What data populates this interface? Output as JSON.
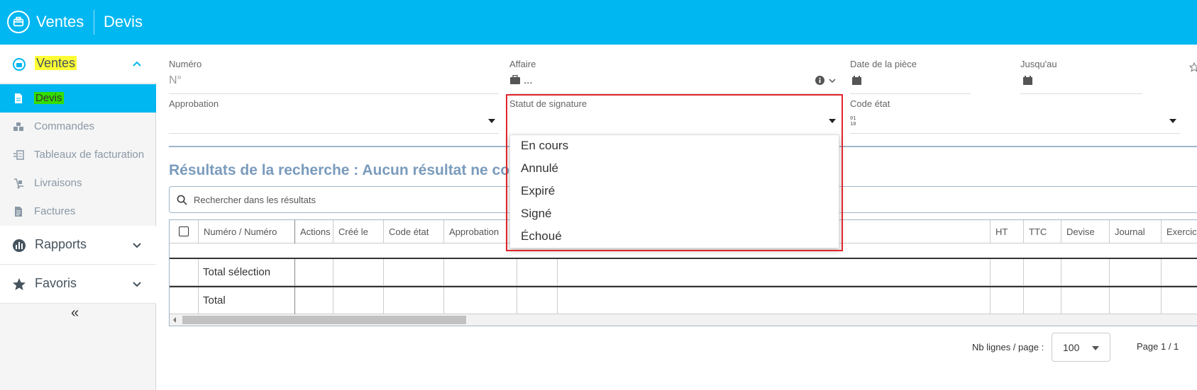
{
  "topbar": {
    "app": "Ventes",
    "page": "Devis"
  },
  "sidebar": {
    "ventes_section": "Ventes",
    "items": [
      {
        "label": "Devis",
        "icon": "document-icon",
        "active": true
      },
      {
        "label": "Commandes",
        "icon": "boxes-icon"
      },
      {
        "label": "Tableaux de facturation",
        "icon": "billing-table-icon"
      },
      {
        "label": "Livraisons",
        "icon": "hand-truck-icon"
      },
      {
        "label": "Factures",
        "icon": "invoice-icon"
      }
    ],
    "rapports": "Rapports",
    "favoris": "Favoris",
    "collapse": "«"
  },
  "form": {
    "numero_label": "Numéro",
    "numero_placeholder": "N°",
    "affaire_label": "Affaire",
    "affaire_value": "...",
    "date_label": "Date de la pièce",
    "jusqu_label": "Jusqu'au",
    "approbation_label": "Approbation",
    "statut_label": "Statut de signature",
    "code_etat_label": "Code état"
  },
  "results": {
    "title": "Résultats de la recherche : Aucun résultat ne corr",
    "search_placeholder": "Rechercher dans les résultats"
  },
  "table": {
    "headers": [
      "Numéro / Numéro",
      "Actions",
      "Créé le",
      "Code état",
      "Approbation",
      "HT",
      "TTC",
      "Devise",
      "Journal",
      "Exercice"
    ],
    "total_selection": "Total sélection",
    "total": "Total"
  },
  "pagination": {
    "label": "Nb lignes / page :",
    "value": "100",
    "page": "Page 1 / 1"
  },
  "dropdown": {
    "options": [
      "En cours",
      "Annulé",
      "Expiré",
      "Signé",
      "Échoué"
    ]
  },
  "colors": {
    "brand": "#00b7f1",
    "highlight_yellow": "#ffff33",
    "highlight_green": "#33dd00",
    "annotation_red": "#e0262c"
  }
}
